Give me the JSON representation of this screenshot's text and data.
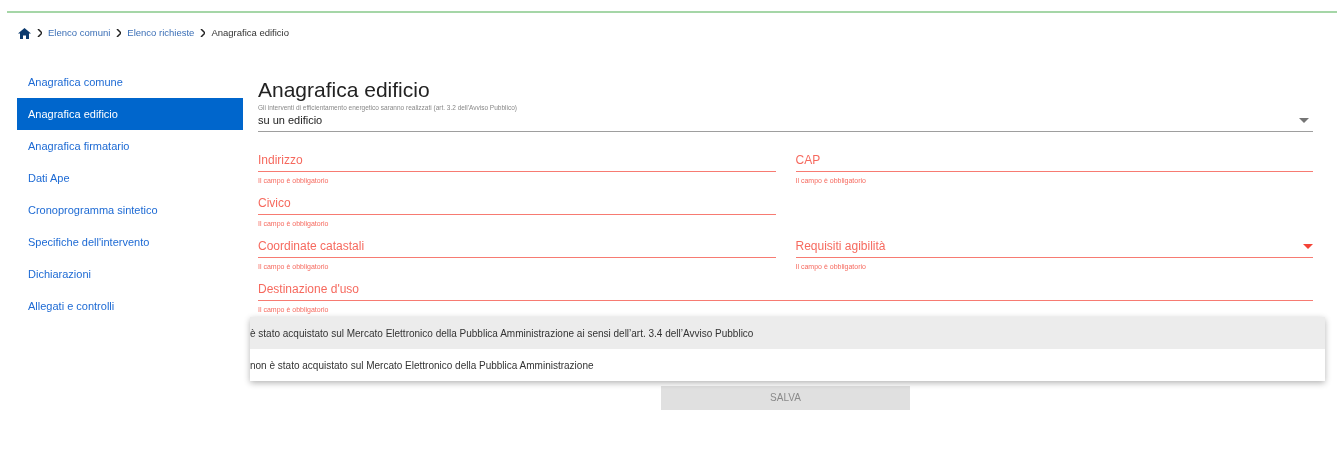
{
  "breadcrumb": [
    "Elenco comuni",
    "Elenco richieste",
    "Anagrafica edificio"
  ],
  "sidebar": {
    "items": [
      {
        "label": "Anagrafica comune",
        "selected": false
      },
      {
        "label": "Anagrafica edificio",
        "selected": true
      },
      {
        "label": "Anagrafica firmatario",
        "selected": false
      },
      {
        "label": "Dati Ape",
        "selected": false
      },
      {
        "label": "Cronoprogramma sintetico",
        "selected": false
      },
      {
        "label": "Specifiche dell'intervento",
        "selected": false
      },
      {
        "label": "Dichiarazioni",
        "selected": false
      },
      {
        "label": "Allegati e controlli",
        "selected": false
      }
    ]
  },
  "title": "Anagrafica edificio",
  "intervention_select": {
    "label": "Gli interventi di efficientamento energetico saranno realizzati (art. 3.2 dell'Avviso Pubblico)",
    "value": "su un edificio"
  },
  "form_rows": [
    [
      {
        "kind": "text",
        "label": "Indirizzo",
        "error": "Il campo è obbligatorio"
      },
      {
        "kind": "text",
        "label": "CAP",
        "error": "Il campo è obbligatorio"
      }
    ],
    [
      {
        "kind": "text",
        "label": "Civico",
        "error": "Il campo è obbligatorio"
      }
    ],
    [
      {
        "kind": "text",
        "label": "Coordinate catastali",
        "error": "Il campo è obbligatorio"
      },
      {
        "kind": "select",
        "label": "Requisiti agibilità",
        "error": "Il campo è obbligatorio"
      }
    ],
    [
      {
        "kind": "wide",
        "label": "Destinazione d'uso",
        "error": "Il campo è obbligatorio"
      }
    ]
  ],
  "dropdown_menu": [
    {
      "label": "è stato acquistato sul Mercato Elettronico della Pubblica Amministrazione ai sensi dell’art. 3.4 dell’Avviso Pubblico",
      "selected": true
    },
    {
      "label": "non è stato acquistato sul Mercato Elettronico della Pubblica Amministrazione",
      "selected": false
    }
  ],
  "save_button": {
    "label": "SALVA",
    "disabled": true
  }
}
